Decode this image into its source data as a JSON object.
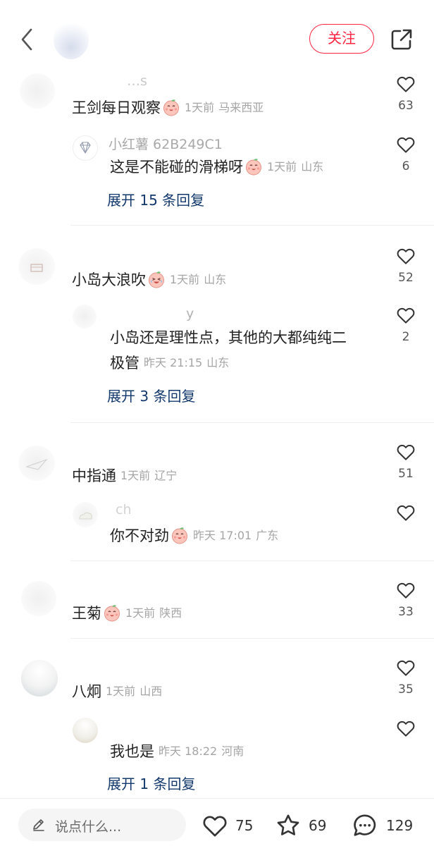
{
  "header": {
    "follow_label": "关注"
  },
  "comments": [
    {
      "username": "…s",
      "text": "王剑每日观察",
      "emoji": "happy-peach-emoji",
      "time": "1天前",
      "location": "马来西亚",
      "likes": "63",
      "reply": {
        "username": "小红薯 62B249C1",
        "text": "这是不能碰的滑梯呀",
        "emoji": "happy-peach-emoji",
        "time": "1天前",
        "location": "山东",
        "likes": "6"
      },
      "expand": "展开 15 条回复"
    },
    {
      "username": "",
      "text": "小岛大浪吹",
      "emoji": "crying-laugh-emoji",
      "time": "1天前",
      "location": "山东",
      "likes": "52",
      "reply": {
        "username": "y",
        "text_line1": "小岛还是理性点，其他的大都纯纯二",
        "text_line2": "极管",
        "time": "昨天 21:15",
        "location": "山东",
        "likes": "2"
      },
      "expand": "展开 3 条回复"
    },
    {
      "username": "",
      "text": "中指通",
      "time": "1天前",
      "location": "辽宁",
      "likes": "51",
      "reply": {
        "username": "ch",
        "text": "你不对劲",
        "emoji": "happy-peach-emoji",
        "time": "昨天 17:01",
        "location": "广东",
        "likes": ""
      }
    },
    {
      "username": "",
      "text": "王菊",
      "emoji": "happy-peach-emoji",
      "time": "1天前",
      "location": "陕西",
      "likes": "33"
    },
    {
      "username": "",
      "text": "八炯",
      "time": "1天前",
      "location": "山西",
      "likes": "35",
      "reply": {
        "username": "",
        "text": "我也是",
        "time": "昨天 18:22",
        "location": "河南",
        "likes": ""
      },
      "expand": "展开 1 条回复"
    }
  ],
  "footer": {
    "input_placeholder": "说点什么...",
    "likes": "75",
    "favorites": "69",
    "comments": "129"
  },
  "colors": {
    "accent": "#ff2442",
    "link": "#13386c",
    "meta": "#a5a5a5"
  }
}
